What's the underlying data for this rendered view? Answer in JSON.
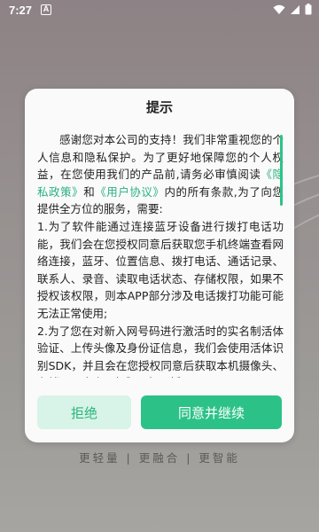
{
  "status_bar": {
    "time": "7:27",
    "notification_icon": "A",
    "icons": [
      "wifi-icon",
      "signal-icon",
      "battery-icon"
    ]
  },
  "dialog": {
    "title": "提示",
    "intro_before_links": "感谢您对本公司的支持！我们非常重视您的个人信息和隐私保护。为了更好地保障您的个人权益，在您使用我们的产品前,请务必审慎阅读",
    "privacy_link": "《隐私政策》",
    "and_text": "和",
    "user_agreement_link": "《用户协议》",
    "intro_after_links": "内的所有条款,为了向您提供全方位的服务，需要:",
    "item_1": "1.为了软件能通过连接蓝牙设备进行拨打电话功能，我们会在您授权同意后获取您手机终端查看网络连接，蓝牙、位置信息、拨打电话、通话记录、联系人、录音、读取电话状态、存储权限，如果不授权该权限，则本APP部分涉及电话拨打功能可能无法正常使用;",
    "item_2": "2.为了您在对新入网号码进行激活时的实名制活体验证、上传头像及身份证信息，我们会使用活体识别SDK，并且会在您授权同意后获取本机摄像头、存储以及麦克风权限，如不授予",
    "reject_label": "拒绝",
    "accept_label": "同意并继续"
  },
  "slogan": "更轻量 | 更融合 | 更智能",
  "colors": {
    "accent": "#2cc287",
    "accent_light": "#d8f3e7",
    "link": "#28b27f"
  }
}
